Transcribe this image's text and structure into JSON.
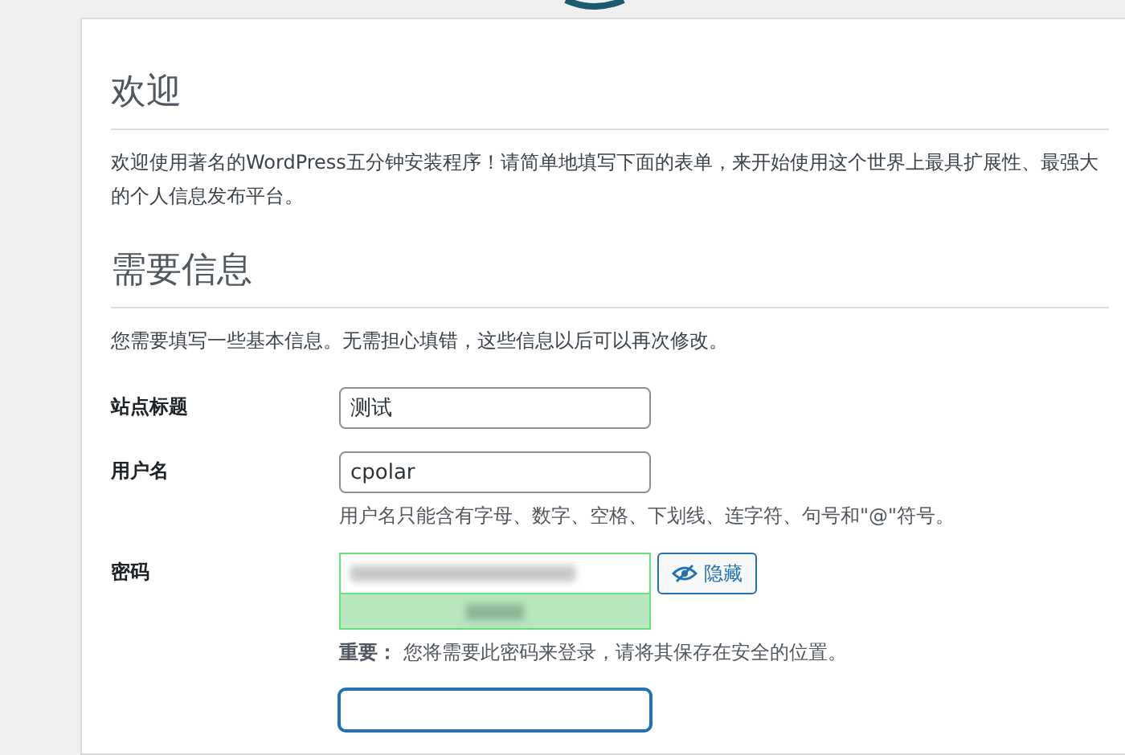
{
  "welcome": {
    "heading": "欢迎",
    "text": "欢迎使用著名的WordPress五分钟安装程序！请简单地填写下面的表单，来开始使用这个世界上最具扩展性、最强大的个人信息发布平台。"
  },
  "info": {
    "heading": "需要信息",
    "text": "您需要填写一些基本信息。无需担心填错，这些信息以后可以再次修改。"
  },
  "form": {
    "site_title": {
      "label": "站点标题",
      "value": "测试"
    },
    "username": {
      "label": "用户名",
      "value": "cpolar",
      "hint": "用户名只能含有字母、数字、空格、下划线、连字符、句号和\"@\"符号。"
    },
    "password": {
      "label": "密码",
      "hide_button": "隐藏",
      "note": "**重要：** 您将需要此密码来登录，请将其保存在安全的位置。"
    },
    "next_field": {
      "focused": true
    }
  }
}
